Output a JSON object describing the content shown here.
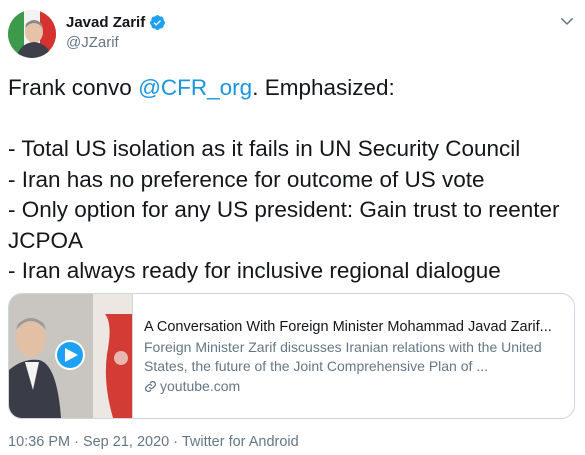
{
  "user": {
    "display_name": "Javad Zarif",
    "handle": "@JZarif"
  },
  "tweet": {
    "text_before": "Frank convo ",
    "mention": "@CFR_org",
    "text_after": ". Emphasized:\n\n- Total US isolation as it fails in UN Security Council\n- Iran has no preference for outcome of US vote\n- Only option for any US president: Gain trust to reenter JCPOA\n- Iran always ready for inclusive regional dialogue"
  },
  "card": {
    "title": "A Conversation With Foreign Minister Mohammad Javad Zarif...",
    "description": "Foreign Minister Zarif discusses Iranian relations with the United States, the future of the Joint Comprehensive Plan of ...",
    "domain": "youtube.com"
  },
  "meta": "10:36 PM · Sep 21, 2020 · Twitter for Android",
  "icons": {
    "verified": "verified-badge-icon",
    "more": "chevron-down-icon",
    "play": "play-icon",
    "link": "link-icon"
  },
  "colors": {
    "link": "#1b95e0",
    "secondary": "#657786",
    "border": "#ccd6dd",
    "verified": "#1da1f2"
  }
}
